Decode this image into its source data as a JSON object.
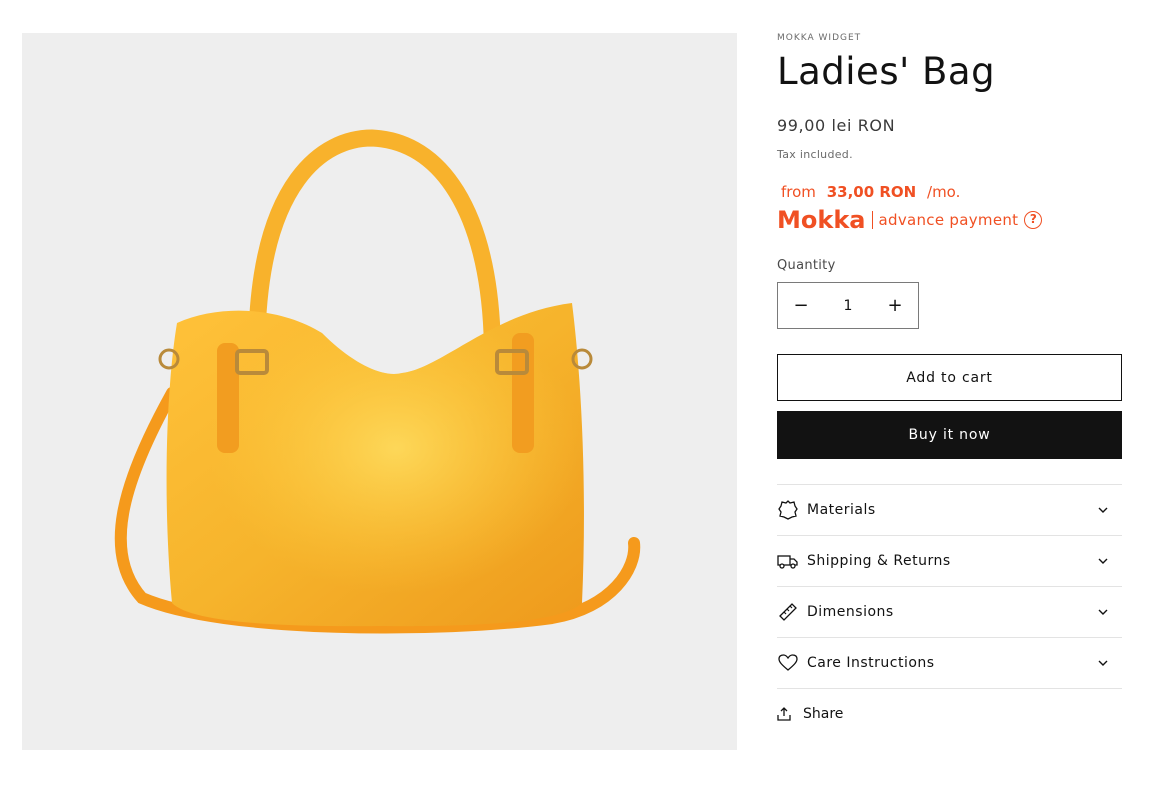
{
  "product": {
    "vendor": "MOKKA WIDGET",
    "title": "Ladies' Bag",
    "price": "99,00 lei RON",
    "tax_note": "Tax included.",
    "image_subject": "bag-image"
  },
  "mokka": {
    "from_label": "from",
    "amount": "33,00 RON",
    "per": "/mo.",
    "logo": "Mokka",
    "text": "advance payment",
    "help": "?",
    "color": "#f05023"
  },
  "quantity": {
    "label": "Quantity",
    "value": "1",
    "minus": "−",
    "plus": "+"
  },
  "buttons": {
    "add_to_cart": "Add to cart",
    "buy_now": "Buy it now"
  },
  "accordions": [
    {
      "label": "Materials",
      "icon": "leather-icon"
    },
    {
      "label": "Shipping & Returns",
      "icon": "truck-icon"
    },
    {
      "label": "Dimensions",
      "icon": "ruler-icon"
    },
    {
      "label": "Care Instructions",
      "icon": "heart-icon"
    }
  ],
  "share": {
    "label": "Share",
    "icon": "share-icon"
  },
  "colors": {
    "bag": "#f4b02c",
    "background": "#eeeeee",
    "dark": "#121212"
  }
}
